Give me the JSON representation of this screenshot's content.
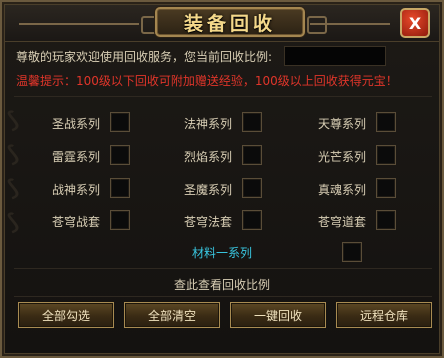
{
  "title": "装备回收",
  "close_label": "X",
  "welcome_text": "尊敬的玩家欢迎使用回收服务，您当前回收比例:",
  "ratio_value": "",
  "tip_text": "温馨提示：100级以下回收可附加赠送经验，100级以上回收获得元宝！",
  "items": [
    {
      "label": "圣战系列"
    },
    {
      "label": "法神系列"
    },
    {
      "label": "天尊系列"
    },
    {
      "label": "雷霆系列"
    },
    {
      "label": "烈焰系列"
    },
    {
      "label": "光芒系列"
    },
    {
      "label": "战神系列"
    },
    {
      "label": "圣魔系列"
    },
    {
      "label": "真魂系列"
    },
    {
      "label": "苍穹战套"
    },
    {
      "label": "苍穹法套"
    },
    {
      "label": "苍穹道套"
    }
  ],
  "material_label": "材料一系列",
  "view_ratio_label": "查此查看回收比例",
  "buttons": {
    "select_all": "全部勾选",
    "clear_all": "全部清空",
    "one_click": "一键回收",
    "warehouse": "远程仓库"
  },
  "colors": {
    "title": "#f4d88a",
    "tip": "#e0352a",
    "material": "#39c6e0",
    "text": "#d9cfb5",
    "close_bg": "#c8321c"
  }
}
